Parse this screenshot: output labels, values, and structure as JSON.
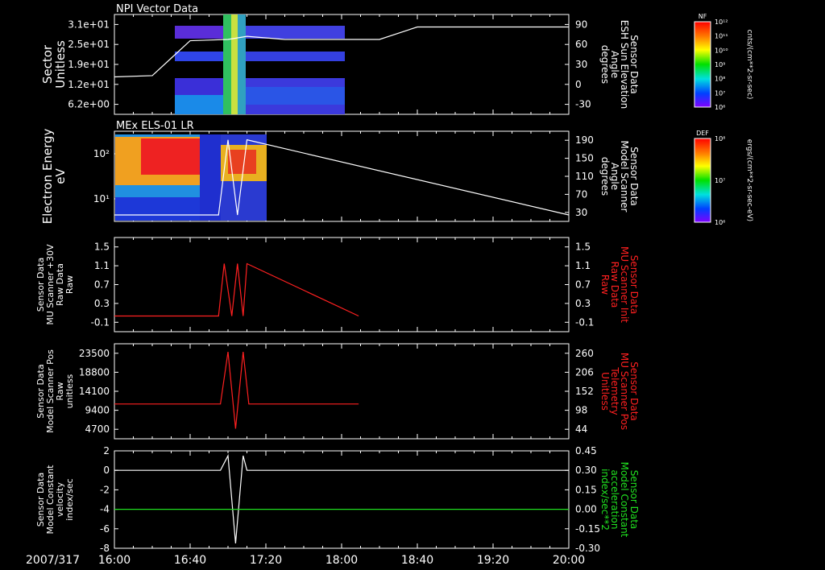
{
  "date_label": "2007/317",
  "time_ticks": [
    "16:00",
    "16:40",
    "17:20",
    "18:00",
    "18:40",
    "19:20",
    "20:00"
  ],
  "colors": {
    "background": "#000000",
    "axes": "#ffffff",
    "red_trace": "#ff2020",
    "green_trace": "#20e020"
  },
  "panels": [
    {
      "id": "npi",
      "title": "NPI Vector Data",
      "ylabel": [
        "Sector",
        "Unitless"
      ],
      "ylabel_color": "#ffffff",
      "yticks": [
        "3.1e+01",
        "2.5e+01",
        "1.9e+01",
        "1.2e+01",
        "6.2e+00"
      ],
      "y2label": [
        "Sensor Data",
        "ESH Sun Elevation",
        "Angle",
        "degrees"
      ],
      "y2label_color": "#ffffff",
      "y2ticks": [
        "90",
        "60",
        "30",
        "0",
        "-30"
      ]
    },
    {
      "id": "els",
      "title": "MEx ELS-01 LR",
      "ylabel": [
        "Electron Energy",
        "eV"
      ],
      "ylabel_color": "#ffffff",
      "yticks": [
        "10²",
        "10¹"
      ],
      "y2label": [
        "Sensor Data",
        "Model Scanner",
        "Angle",
        "degrees"
      ],
      "y2label_color": "#ffffff",
      "y2ticks": [
        "190",
        "150",
        "110",
        "70",
        "30"
      ]
    },
    {
      "id": "mu30",
      "title": "",
      "ylabel": [
        "Sensor Data",
        "MU Scanner +30V",
        "Raw Data",
        "Raw"
      ],
      "ylabel_color": "#ffffff",
      "yticks": [
        "1.5",
        "1.1",
        "0.7",
        "0.3",
        "-0.1"
      ],
      "y2label": [
        "Sensor Data",
        "MU Scanner Init",
        "Raw Data",
        "Raw"
      ],
      "y2label_color": "#ff2020",
      "y2ticks": [
        "1.5",
        "1.1",
        "0.7",
        "0.3",
        "-0.1"
      ]
    },
    {
      "id": "pos",
      "title": "",
      "ylabel": [
        "Sensor Data",
        "Model Scanner Pos",
        "Raw",
        "unitless"
      ],
      "ylabel_color": "#ffffff",
      "yticks": [
        "23500",
        "18800",
        "14100",
        "9400",
        "4700"
      ],
      "y2label": [
        "Sensor Data",
        "MU Scanner Pos",
        "Telemetry",
        "Unitless"
      ],
      "y2label_color": "#ff2020",
      "y2ticks": [
        "260",
        "206",
        "152",
        "98",
        "44"
      ]
    },
    {
      "id": "vel",
      "title": "",
      "ylabel": [
        "Sensor Data",
        "Model Constant",
        "velocity",
        "index/sec"
      ],
      "ylabel_color": "#ffffff",
      "yticks": [
        "2",
        "0",
        "-2",
        "-4",
        "-6",
        "-8"
      ],
      "y2label": [
        "Sensor Data",
        "Model Constant",
        "acceleration",
        "index/sec**2"
      ],
      "y2label_color": "#20e020",
      "y2ticks": [
        "0.45",
        "0.30",
        "0.15",
        "0.00",
        "-0.15",
        "-0.30"
      ]
    }
  ],
  "colorbars": [
    {
      "id": "npi-cb",
      "tag": "NF",
      "ticks": [
        "10¹²",
        "10¹¹",
        "10¹⁰",
        "10⁹",
        "10⁸",
        "10⁷",
        "10⁶"
      ],
      "units": "cnts/(cm**2-sr-sec)"
    },
    {
      "id": "els-cb",
      "tag": "DEF",
      "ticks": [
        "10⁸",
        "10⁷",
        "10⁶"
      ],
      "units": "ergs/(cm**2-sr-sec-eV)"
    }
  ],
  "chart_data": [
    {
      "type": "heatmap",
      "panel": "npi",
      "description_series": [
        {
          "name": "ESH Sun Elevation Angle",
          "x": [
            "16:00",
            "16:20",
            "16:30",
            "16:40",
            "17:00",
            "17:10",
            "17:30",
            "18:20",
            "18:40",
            "20:00"
          ],
          "y": [
            0,
            2,
            30,
            58,
            60,
            65,
            60,
            60,
            80,
            80
          ]
        }
      ]
    },
    {
      "type": "heatmap",
      "panel": "els",
      "description_series": [
        {
          "name": "Model Scanner Angle",
          "x": [
            "16:00",
            "16:55",
            "17:00",
            "17:05",
            "17:10",
            "20:00"
          ],
          "y": [
            5,
            5,
            180,
            5,
            180,
            5
          ]
        }
      ]
    },
    {
      "type": "line",
      "panel": "mu30",
      "ylim": [
        -0.3,
        1.5
      ],
      "series": [
        {
          "name": "MU Scanner Init Raw Data",
          "x": [
            "16:00",
            "16:55",
            "16:58",
            "17:02",
            "17:05",
            "17:08",
            "17:10",
            "18:09"
          ],
          "y": [
            0,
            0,
            1,
            0,
            1,
            0,
            1,
            0
          ]
        }
      ]
    },
    {
      "type": "line",
      "panel": "pos",
      "ylim": [
        0,
        23500
      ],
      "series": [
        {
          "name": "MU Scanner Pos Telemetry",
          "x": [
            "16:00",
            "16:56",
            "17:00",
            "17:04",
            "17:08",
            "17:11",
            "18:09"
          ],
          "y": [
            8600,
            8600,
            21500,
            2500,
            21500,
            8600,
            8600
          ]
        }
      ]
    },
    {
      "type": "line",
      "panel": "vel",
      "ylim": [
        -8,
        2
      ],
      "series": [
        {
          "name": "Model Constant velocity",
          "x": [
            "16:00",
            "16:56",
            "17:00",
            "17:04",
            "17:08",
            "17:10",
            "20:00"
          ],
          "y": [
            0,
            0,
            1.5,
            -7.5,
            1.5,
            0,
            0
          ]
        },
        {
          "name": "Model Constant acceleration",
          "x": [
            "16:00",
            "20:00"
          ],
          "y": [
            0,
            0
          ]
        }
      ]
    }
  ]
}
